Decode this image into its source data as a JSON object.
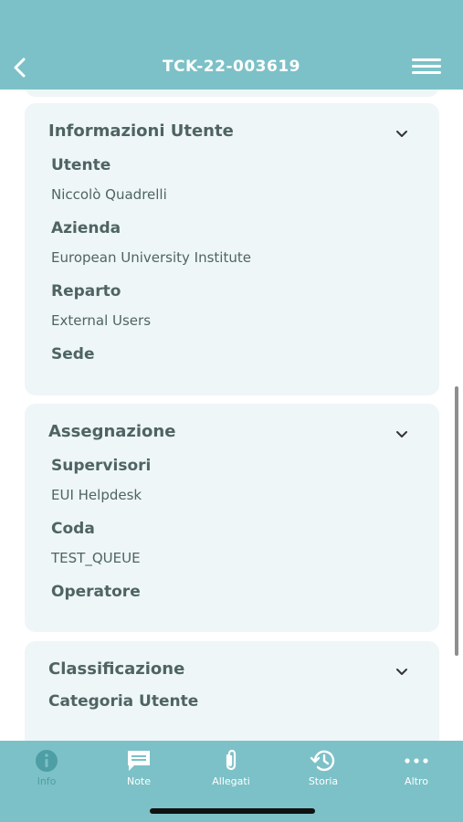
{
  "header": {
    "title": "TCK-22-003619"
  },
  "sections": [
    {
      "title": "Informazioni Utente",
      "fields": [
        {
          "label": "Utente",
          "value": "Niccolò Quadrelli"
        },
        {
          "label": "Azienda",
          "value": "European University Institute"
        },
        {
          "label": "Reparto",
          "value": "External Users"
        },
        {
          "label": "Sede",
          "value": ""
        }
      ]
    },
    {
      "title": "Assegnazione",
      "fields": [
        {
          "label": "Supervisori",
          "value": "EUI Helpdesk"
        },
        {
          "label": "Coda",
          "value": "TEST_QUEUE"
        },
        {
          "label": "Operatore",
          "value": ""
        }
      ]
    },
    {
      "title": "Classificazione",
      "fields": [
        {
          "label": "Categoria Utente",
          "value": ""
        }
      ]
    }
  ],
  "tabbar": {
    "active": "Info",
    "tabs": [
      {
        "label": "Info",
        "icon": "info-icon"
      },
      {
        "label": "Note",
        "icon": "chat-icon"
      },
      {
        "label": "Allegati",
        "icon": "paperclip-icon"
      },
      {
        "label": "Storia",
        "icon": "history-icon"
      },
      {
        "label": "Altro",
        "icon": "more-icon"
      }
    ]
  },
  "colors": {
    "header": "#7cc1c7",
    "card": "#eef6f8",
    "text": "#4f6462",
    "active_tab": "#4e9ea6"
  }
}
